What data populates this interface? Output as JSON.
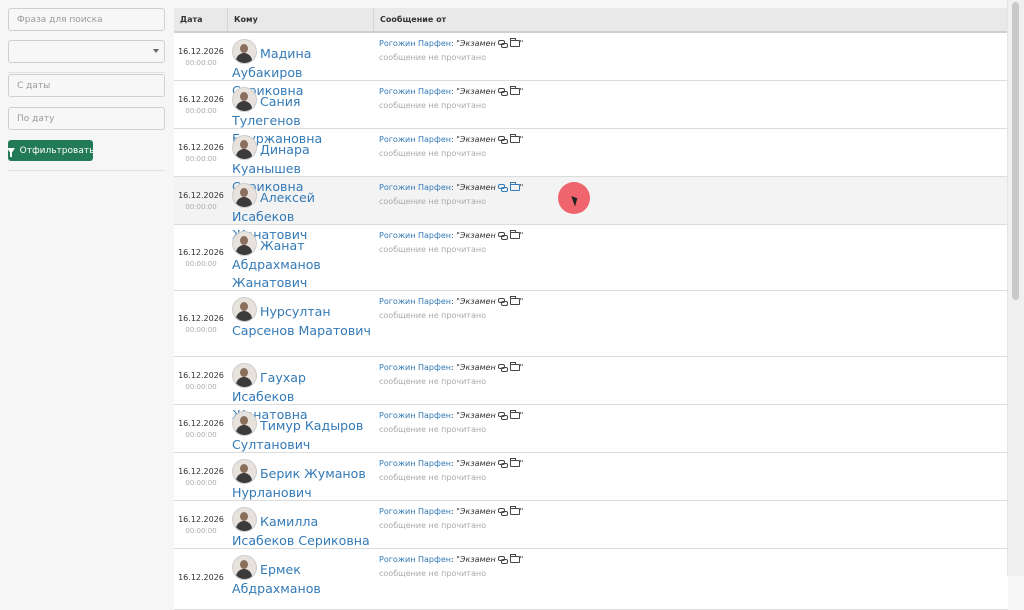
{
  "filters": {
    "search_placeholder": "Фраза для поиска",
    "select_value": "",
    "date_from_placeholder": "С даты",
    "date_to_placeholder": "По дату",
    "filter_button": "Отфильтровать"
  },
  "table": {
    "headers": {
      "date": "Дата",
      "to": "Кому",
      "from": "Сообщение от"
    },
    "rows": [
      {
        "date": "16.12.2026",
        "time": "00:00:00",
        "recipient": "Мадина Аубакиров Сериковна",
        "sender": "Рогожин Парфен",
        "subject_prefix": ": \"",
        "subject": "Экзамен",
        "subject_suffix": "\"",
        "status": "сообщение не прочитано"
      },
      {
        "date": "16.12.2026",
        "time": "00:00:00",
        "recipient": "Сания Тулегенов Бауржановна",
        "sender": "Рогожин Парфен",
        "subject_prefix": ": \"",
        "subject": "Экзамен",
        "subject_suffix": "\"",
        "status": "сообщение не прочитано"
      },
      {
        "date": "16.12.2026",
        "time": "00:00:00",
        "recipient": "Динара Куанышев Сериковна",
        "sender": "Рогожин Парфен",
        "subject_prefix": ": \"",
        "subject": "Экзамен",
        "subject_suffix": "\"",
        "status": "сообщение не прочитано"
      },
      {
        "date": "16.12.2026",
        "time": "00:00:00",
        "recipient": "Алексей Исабеков Жанатович",
        "sender": "Рогожин Парфен",
        "subject_prefix": ": \"",
        "subject": "Экзамен",
        "subject_suffix": "\"",
        "status": "сообщение не прочитано"
      },
      {
        "date": "16.12.2026",
        "time": "00:00:00",
        "recipient": "Жанат Абдрахманов Жанатович",
        "sender": "Рогожин Парфен",
        "subject_prefix": ": \"",
        "subject": "Экзамен",
        "subject_suffix": "\"",
        "status": "сообщение не прочитано"
      },
      {
        "date": "16.12.2026",
        "time": "00:00:00",
        "recipient": "Нурсултан Сарсенов Маратович",
        "sender": "Рогожин Парфен",
        "subject_prefix": ": \"",
        "subject": "Экзамен",
        "subject_suffix": "\"",
        "status": "сообщение не прочитано"
      },
      {
        "date": "16.12.2026",
        "time": "00:00:00",
        "recipient": "Гаухар Исабеков Жанатовна",
        "sender": "Рогожин Парфен",
        "subject_prefix": ": \"",
        "subject": "Экзамен",
        "subject_suffix": "\"",
        "status": "сообщение не прочитано"
      },
      {
        "date": "16.12.2026",
        "time": "00:00:00",
        "recipient": "Тимур Кадыров Султанович",
        "sender": "Рогожин Парфен",
        "subject_prefix": ": \"",
        "subject": "Экзамен",
        "subject_suffix": "\"",
        "status": "сообщение не прочитано"
      },
      {
        "date": "16.12.2026",
        "time": "00:00:00",
        "recipient": "Берик Жуманов Нурланович",
        "sender": "Рогожин Парфен",
        "subject_prefix": ": \"",
        "subject": "Экзамен",
        "subject_suffix": "\"",
        "status": "сообщение не прочитано"
      },
      {
        "date": "16.12.2026",
        "time": "00:00:00",
        "recipient": "Камилла Исабеков Сериковна",
        "sender": "Рогожин Парфен",
        "subject_prefix": ": \"",
        "subject": "Экзамен",
        "subject_suffix": "\"",
        "status": "сообщение не прочитано"
      },
      {
        "date": "16.12.2026",
        "time": "",
        "recipient": "Ермек Абдрахманов",
        "sender": "Рогожин Парфен",
        "subject_prefix": ": \"",
        "subject": "Экзамен",
        "subject_suffix": "\"",
        "status": "сообщение не прочитано"
      }
    ]
  },
  "colors": {
    "accent": "#337ab7",
    "button": "#237a57",
    "cursor": "#ee505a"
  },
  "icons": {
    "filter": "filter-icon",
    "link": "link-icon",
    "folder": "folder-open-icon"
  }
}
